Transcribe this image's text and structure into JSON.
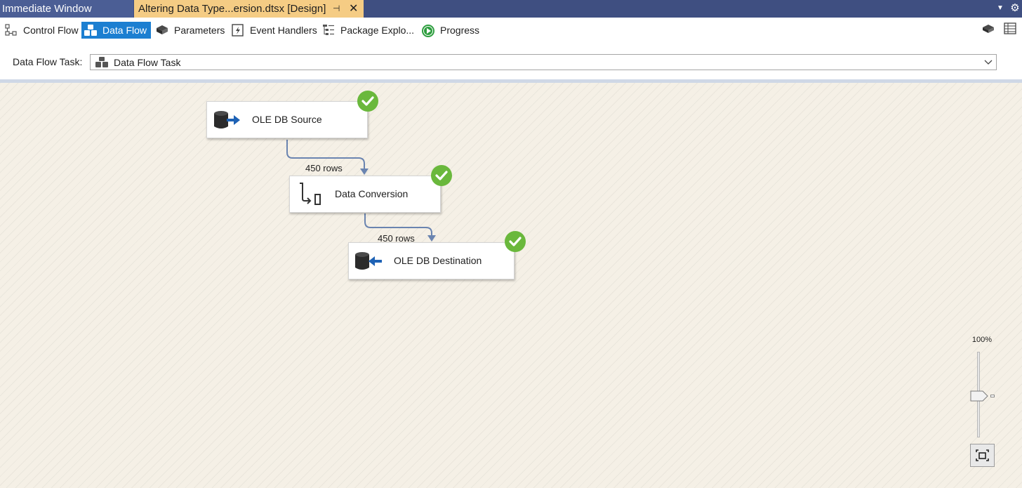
{
  "tabs": {
    "inactive_label": "Immediate Window",
    "active_label": "Altering Data Type...ersion.dtsx [Design]",
    "pin_glyph": "⊣",
    "close_glyph": "✕"
  },
  "designer_tabs": [
    {
      "label": "Control Flow",
      "icon": "control-flow-icon",
      "active": false
    },
    {
      "label": "Data Flow",
      "icon": "data-flow-icon",
      "active": true
    },
    {
      "label": "Parameters",
      "icon": "parameters-icon",
      "active": false
    },
    {
      "label": "Event Handlers",
      "icon": "event-handlers-icon",
      "active": false
    },
    {
      "label": "Package Explo...",
      "icon": "package-explorer-icon",
      "active": false
    },
    {
      "label": "Progress",
      "icon": "progress-icon",
      "active": false
    }
  ],
  "task_selector": {
    "label": "Data Flow Task:",
    "value": "Data Flow Task"
  },
  "components": {
    "source": {
      "label": "OLE DB Source",
      "status": "success"
    },
    "conversion": {
      "label": "Data Conversion",
      "status": "success"
    },
    "destination": {
      "label": "OLE DB Destination",
      "status": "success"
    }
  },
  "paths": {
    "source_to_conversion": "450 rows",
    "conversion_to_destination": "450 rows"
  },
  "zoom": {
    "label": "100%",
    "level_percent": 100
  },
  "colors": {
    "tab_strip": "#3f4f81",
    "active_tab": "#f5cc84",
    "designer_tab_active": "#1c7fd1",
    "success_check": "#6ab83c",
    "connector": "#6a84b0"
  }
}
